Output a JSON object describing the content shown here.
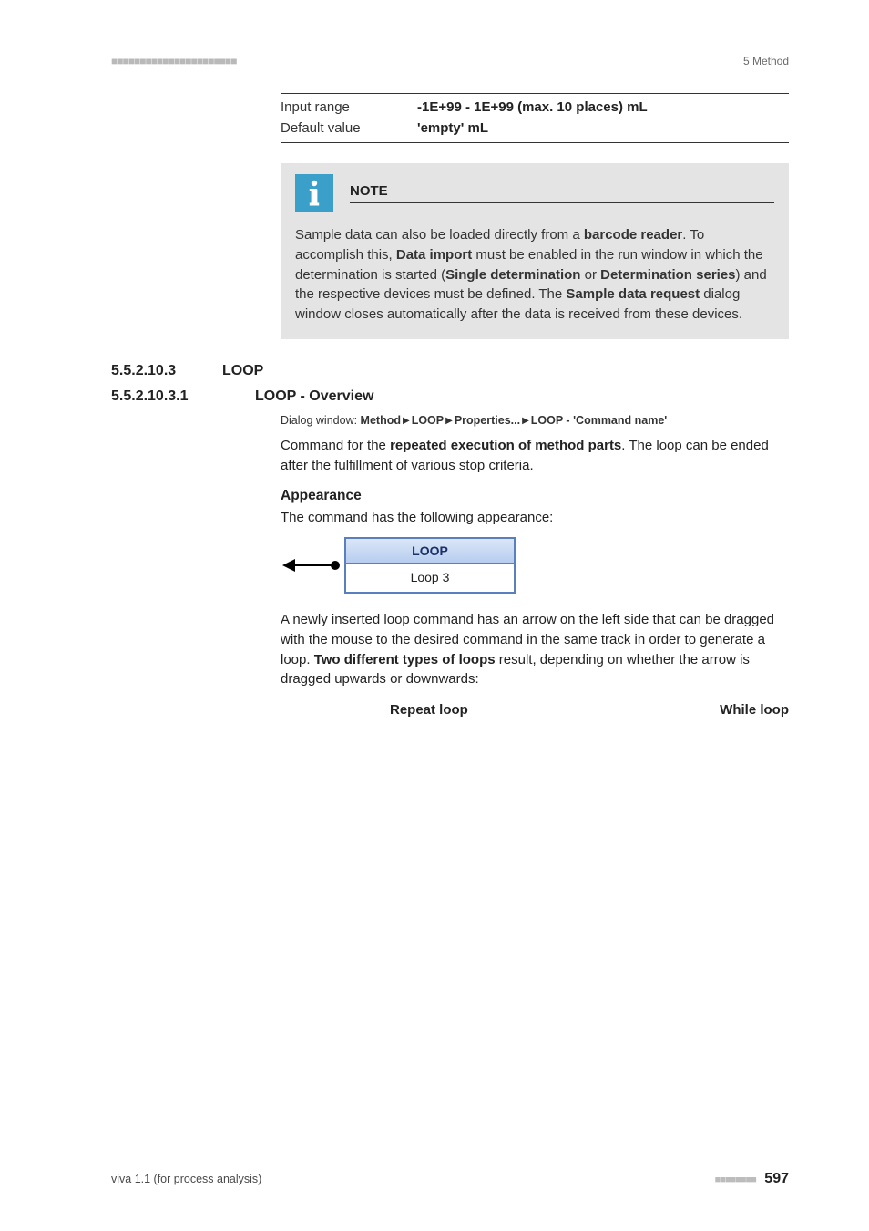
{
  "header": {
    "dashes": "■■■■■■■■■■■■■■■■■■■■■■",
    "right": "5 Method"
  },
  "param_table": {
    "rows": [
      {
        "label": "Input range",
        "value": "-1E+99 - 1E+99 (max. 10 places) mL"
      },
      {
        "label": "Default value",
        "value": "'empty' mL"
      }
    ]
  },
  "note": {
    "title": "NOTE",
    "body_parts": [
      "Sample data can also be loaded directly from a ",
      {
        "b": "barcode reader"
      },
      ". To accomplish this, ",
      {
        "b": "Data import"
      },
      " must be enabled in the run window in which the determination is started (",
      {
        "b": "Single determination"
      },
      " or ",
      {
        "b": "Determination series"
      },
      ") and the respective devices must be defined. The ",
      {
        "b": "Sample data request"
      },
      " dialog window closes automatically after the data is received from these devices."
    ]
  },
  "sections": {
    "loop_num": "5.5.2.10.3",
    "loop_title": "LOOP",
    "overview_num": "5.5.2.10.3.1",
    "overview_title": "LOOP - Overview"
  },
  "dialog_path": {
    "prefix": "Dialog window: ",
    "segments": [
      "Method",
      "LOOP",
      "Properties...",
      "LOOP - 'Command name'"
    ]
  },
  "overview_intro_parts": [
    "Command for the ",
    {
      "b": "repeated execution of method parts"
    },
    ". The loop can be ended after the fulfillment of various stop criteria."
  ],
  "appearance": {
    "heading": "Appearance",
    "lead": "The command has the following appearance:",
    "card_top": "LOOP",
    "card_bottom": "Loop 3"
  },
  "after_figure_parts": [
    "A newly inserted loop command has an arrow on the left side that can be dragged with the mouse to the desired command in the same track in order to generate a loop. ",
    {
      "b": "Two different types of loops"
    },
    " result, depending on whether the arrow is dragged upwards or downwards:"
  ],
  "loop_types": {
    "left": "Repeat loop",
    "right": "While loop"
  },
  "footer": {
    "left": "viva 1.1 (for process analysis)",
    "dashes": "■■■■■■■■",
    "page": "597"
  }
}
